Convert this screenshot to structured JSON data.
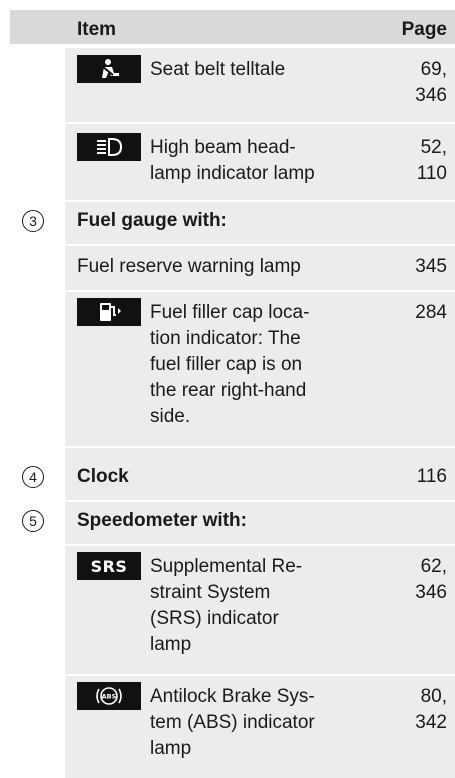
{
  "header": {
    "item": "Item",
    "page": "Page"
  },
  "rows": {
    "seatbelt": {
      "label": "Seat belt telltale",
      "page1": "69,",
      "page2": "346",
      "icon": "seat-belt-icon"
    },
    "highbeam": {
      "line1": "High beam head-",
      "line2": "lamp indicator lamp",
      "page1": "52,",
      "page2": "110",
      "icon": "high-beam-icon"
    },
    "fuel_gauge": {
      "num": "3",
      "label": "Fuel gauge with:"
    },
    "fuel_reserve": {
      "label": "Fuel reserve warning lamp",
      "page": "345"
    },
    "fuel_filler": {
      "line1": "Fuel filler cap loca-",
      "line2": "tion indicator: The",
      "line3": "fuel filler cap is on",
      "line4": "the rear right-hand",
      "line5": "side.",
      "page": "284",
      "icon": "fuel-pump-icon"
    },
    "clock": {
      "num": "4",
      "label": "Clock",
      "page": "116"
    },
    "speedo": {
      "num": "5",
      "label": "Speedometer with:"
    },
    "srs": {
      "icon_text": "SRS",
      "line1": "Supplemental Re-",
      "line2": "straint System",
      "line3": "(SRS) indicator",
      "line4": "lamp",
      "page1": "62,",
      "page2": "346"
    },
    "abs": {
      "icon_text": "ABS",
      "line1": "Antilock Brake Sys-",
      "line2": "tem (ABS) indicator",
      "line3": "lamp",
      "page1": "80,",
      "page2": "342"
    }
  }
}
